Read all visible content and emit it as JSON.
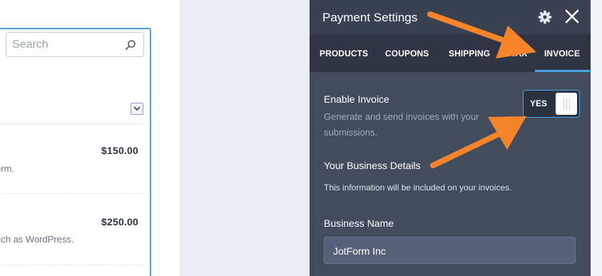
{
  "left": {
    "search": {
      "placeholder": "Search",
      "value": ""
    },
    "products": [
      {
        "price": "$150.00",
        "description_fragment": "orm."
      },
      {
        "price": "$250.00",
        "description_fragment": "uch as WordPress."
      }
    ]
  },
  "panel": {
    "title": "Payment Settings",
    "tabs": [
      {
        "label": "PRODUCTS",
        "active": false
      },
      {
        "label": "COUPONS",
        "active": false
      },
      {
        "label": "SHIPPING",
        "active": false
      },
      {
        "label": "TAX",
        "active": false
      },
      {
        "label": "INVOICE",
        "active": true
      }
    ],
    "enable_invoice": {
      "label": "Enable Invoice",
      "description_line1": "Generate and send invoices with your",
      "description_line2": "submissions.",
      "toggle_text": "YES"
    },
    "business_details": {
      "label": "Your Business Details",
      "note": "This information will be included on your invoices."
    },
    "business_name": {
      "label": "Business Name",
      "value": "JotForm Inc"
    }
  },
  "colors": {
    "accent": "#4aa4e8",
    "panel_bg": "#434c5d",
    "annotation_arrow": "#f5842b"
  },
  "icons": [
    "search-icon",
    "chevron-down-icon",
    "gear-icon",
    "close-icon"
  ]
}
